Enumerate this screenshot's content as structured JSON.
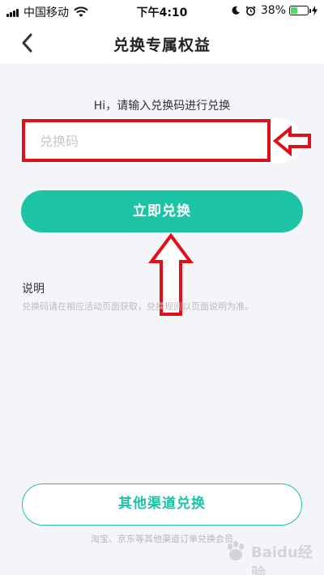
{
  "status_bar": {
    "carrier": "中国移动",
    "time": "下午4:10",
    "battery_percent": "38%",
    "battery_level": 0.38,
    "icons": [
      "signal-icon",
      "wifi-icon",
      "moon-icon",
      "alarm-icon",
      "battery-icon",
      "charging-icon"
    ]
  },
  "nav": {
    "title": "兑换专属权益",
    "back_icon": "chevron-left-icon"
  },
  "redeem": {
    "prompt": "Hi，请输入兑换码进行兑换",
    "code_placeholder": "兑换码",
    "code_value": "",
    "button_label": "立即兑换"
  },
  "description": {
    "title": "说明",
    "text": "兑换码请在相应活动页面获取，兑换规则以页面说明为准。"
  },
  "other_channels": {
    "button_label": "其他渠道兑换",
    "note": "淘宝、京东等其他渠道订单兑换会员"
  },
  "colors": {
    "accent": "#1cc3a5",
    "annotation": "#e0101a",
    "background": "#f4f5f9"
  },
  "watermark": {
    "text": "Baidu经验"
  }
}
